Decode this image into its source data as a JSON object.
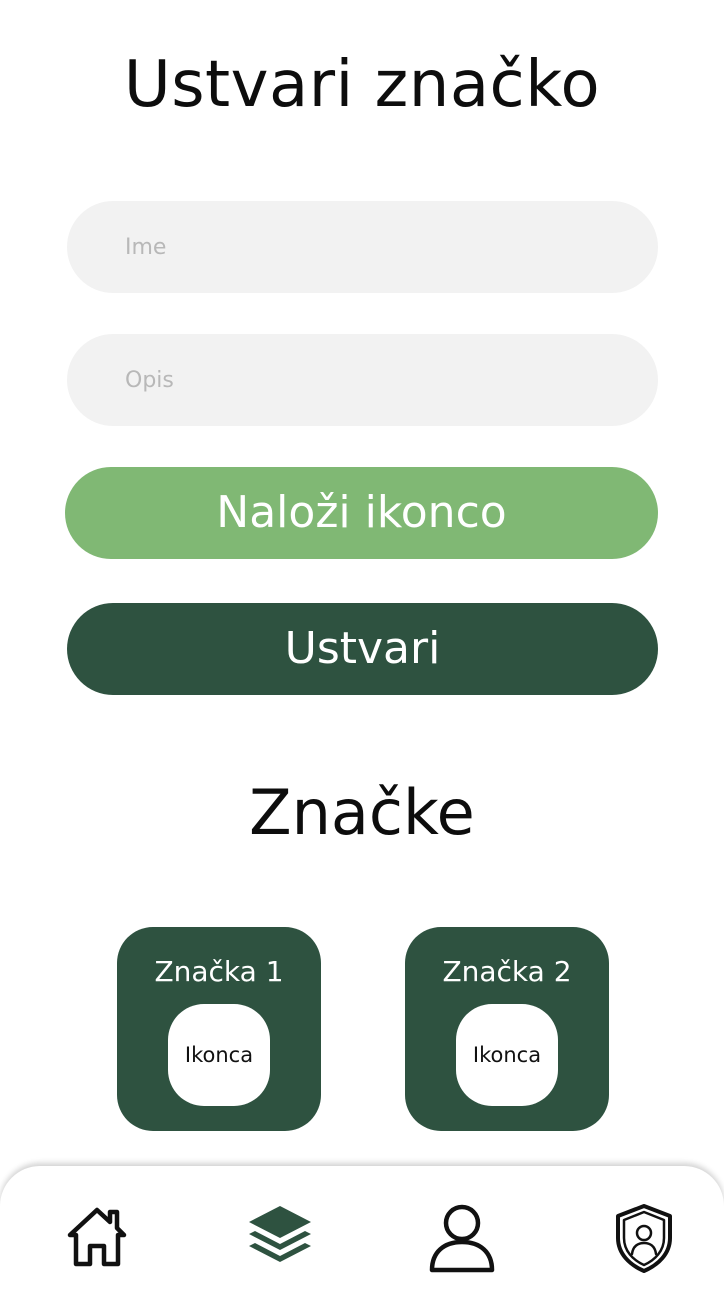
{
  "header": {
    "title": "Ustvari značko"
  },
  "form": {
    "name_placeholder": "Ime",
    "description_placeholder": "Opis",
    "upload_label": "Naloži ikonco",
    "create_label": "Ustvari"
  },
  "badges_section": {
    "title": "Značke",
    "items": [
      {
        "name": "Značka 1",
        "icon_label": "Ikonca"
      },
      {
        "name": "Značka 2",
        "icon_label": "Ikonca"
      }
    ]
  },
  "bottom_nav": {
    "items": [
      {
        "icon": "home-icon"
      },
      {
        "icon": "layers-icon"
      },
      {
        "icon": "user-icon"
      },
      {
        "icon": "shield-user-icon"
      }
    ]
  },
  "colors": {
    "primary_dark_green": "#2e5240",
    "light_green": "#80b874",
    "field_background": "#f2f2f2"
  }
}
